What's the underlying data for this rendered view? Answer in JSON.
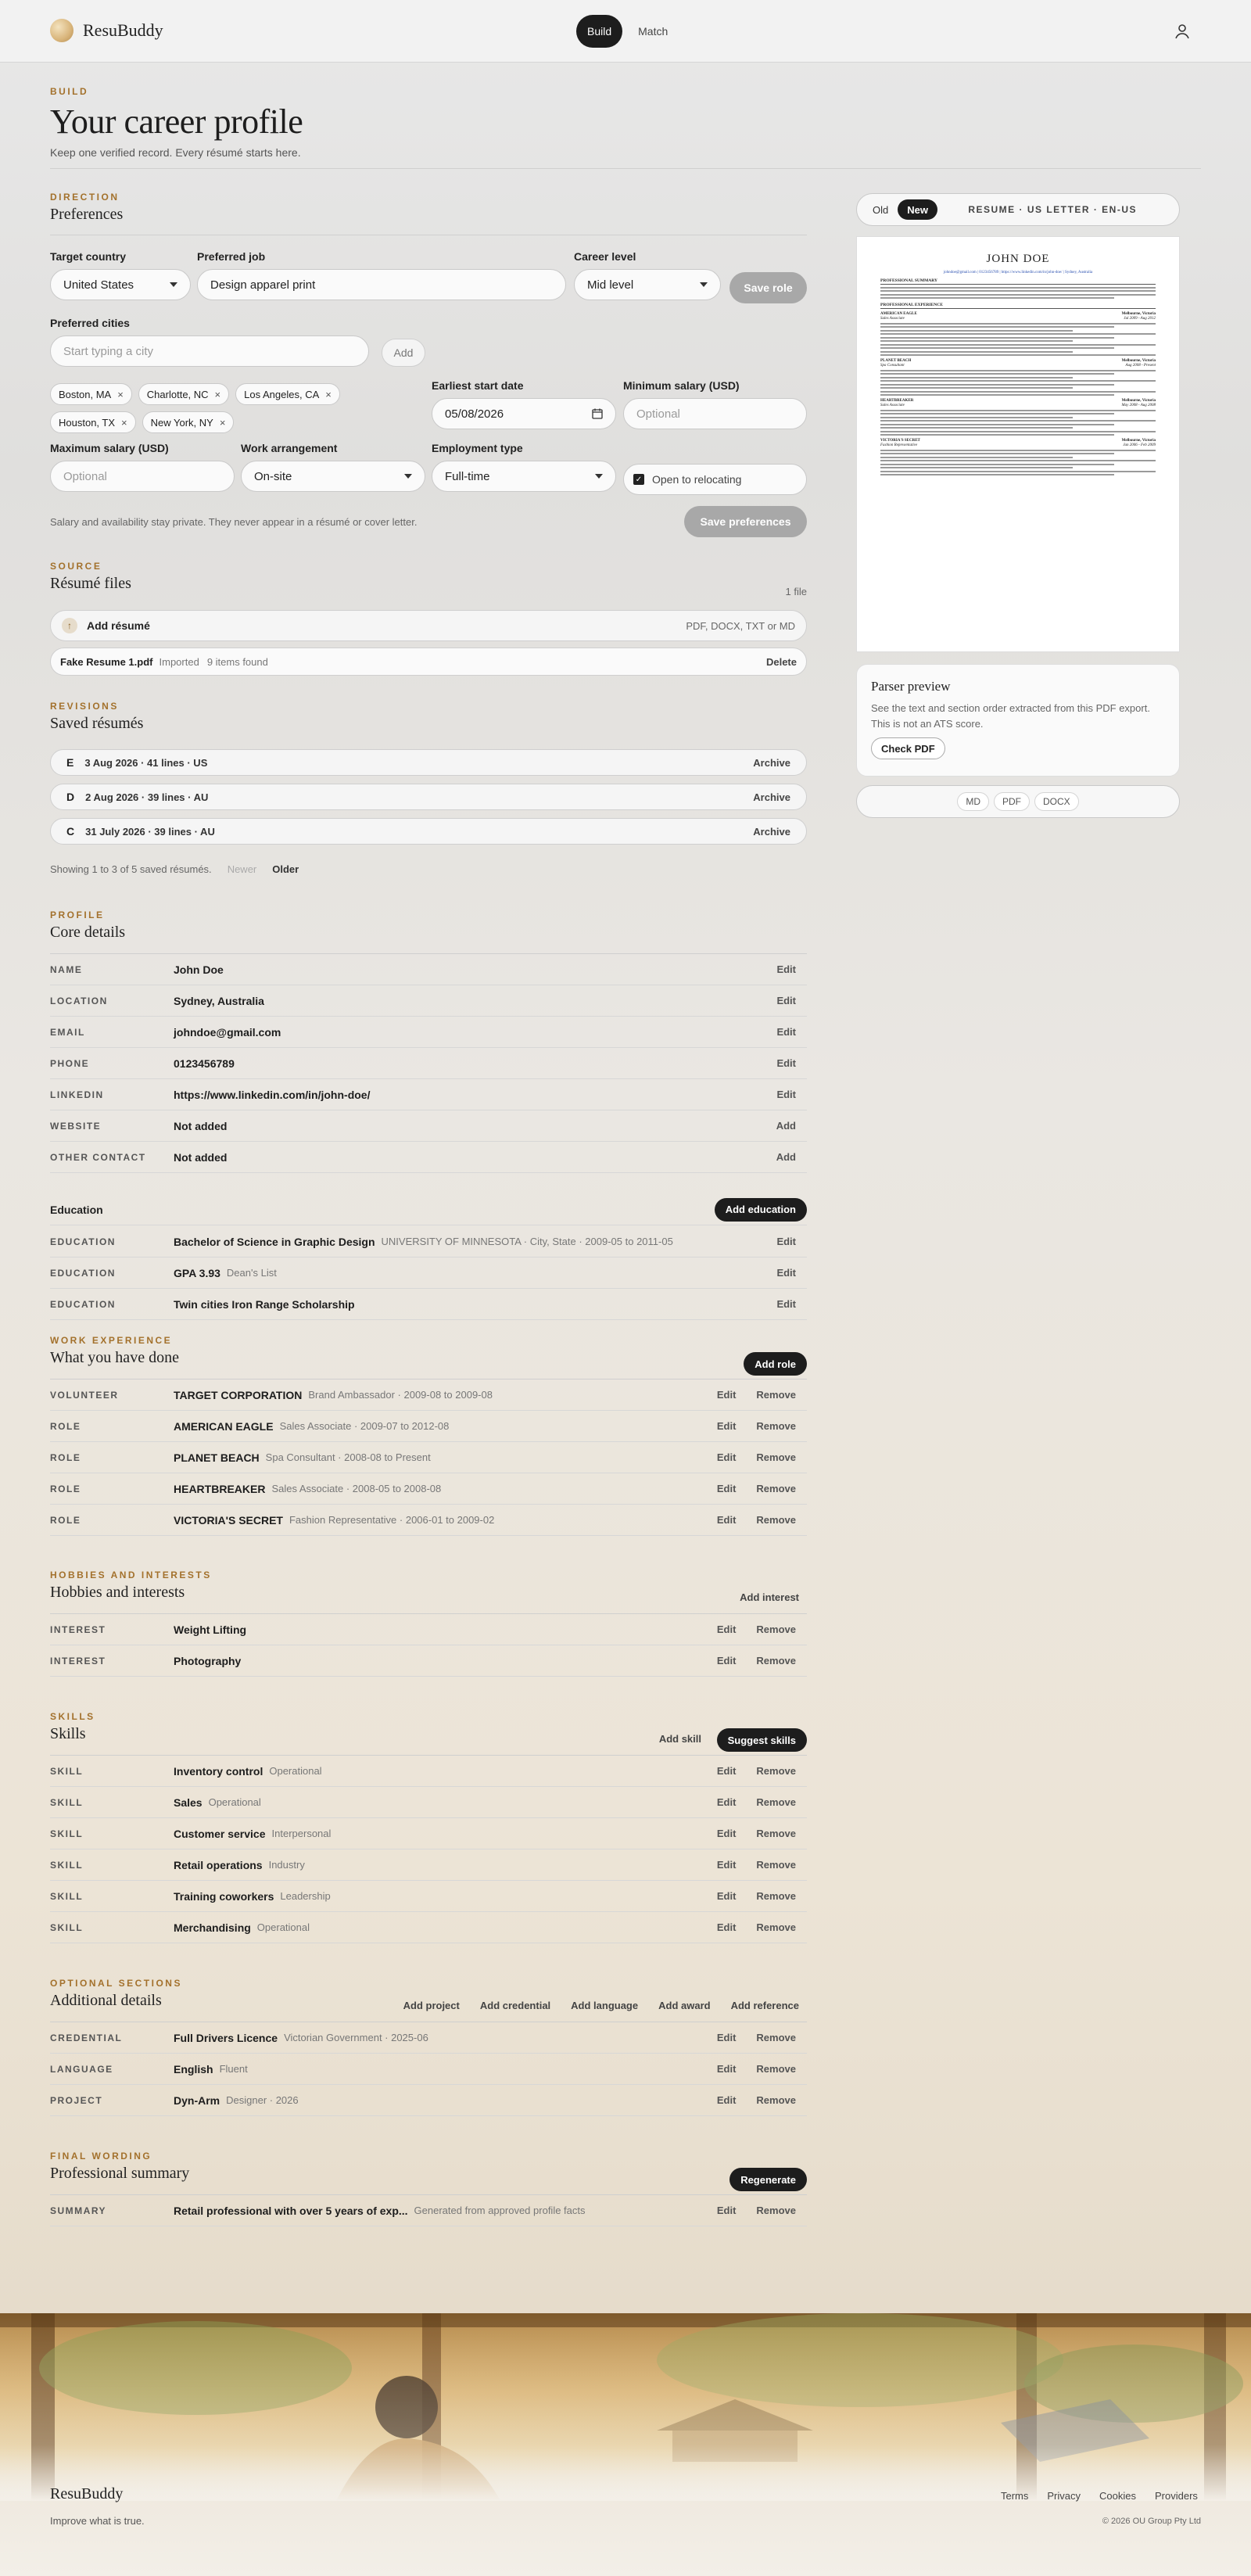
{
  "nav": {
    "brand": "ResuBuddy",
    "tabs": [
      "Build",
      "Match"
    ]
  },
  "header": {
    "eyebrow": "BUILD",
    "title": "Your career profile",
    "subtitle": "Keep one verified record. Every résumé starts here."
  },
  "direction": {
    "eyebrow": "DIRECTION",
    "title": "Preferences",
    "target_country_label": "Target country",
    "target_country": "United States",
    "preferred_job_label": "Preferred job",
    "preferred_job": "Design apparel print",
    "career_level_label": "Career level",
    "career_level": "Mid level",
    "save_role": "Save role",
    "preferred_cities_label": "Preferred cities",
    "city_placeholder": "Start typing a city",
    "add": "Add",
    "cities": [
      "Boston, MA",
      "Charlotte, NC",
      "Los Angeles, CA",
      "Houston, TX",
      "New York, NY"
    ],
    "earliest_start_label": "Earliest start date",
    "earliest_start": "05/08/2026",
    "min_salary_label": "Minimum salary (USD)",
    "min_salary_placeholder": "Optional",
    "max_salary_label": "Maximum salary (USD)",
    "max_salary_placeholder": "Optional",
    "work_arrangement_label": "Work arrangement",
    "work_arrangement": "On-site",
    "employment_type_label": "Employment type",
    "employment_type": "Full-time",
    "relocating": "Open to relocating",
    "privacy_note": "Salary and availability stay private. They never appear in a résumé or cover letter.",
    "save_preferences": "Save preferences"
  },
  "source": {
    "eyebrow": "SOURCE",
    "title": "Résumé files",
    "count": "1 file",
    "add_resume": "Add résumé",
    "formats": "PDF, DOCX, TXT or MD",
    "file_name": "Fake Resume 1.pdf",
    "file_status": "Imported",
    "file_items": "9 items found",
    "delete": "Delete"
  },
  "revisions": {
    "eyebrow": "REVISIONS",
    "title": "Saved résumés",
    "items": [
      {
        "letter": "E",
        "text": "3 Aug 2026 · 41 lines · US",
        "action": "Archive"
      },
      {
        "letter": "D",
        "text": "2 Aug 2026 · 39 lines · AU",
        "action": "Archive"
      },
      {
        "letter": "C",
        "text": "31 July 2026 · 39 lines · AU",
        "action": "Archive"
      }
    ],
    "showing": "Showing 1 to 3 of 5 saved résumés.",
    "newer": "Newer",
    "older": "Older"
  },
  "profile": {
    "eyebrow": "PROFILE",
    "title": "Core details",
    "rows": [
      {
        "k": "NAME",
        "v": "John Doe",
        "a": "Edit"
      },
      {
        "k": "LOCATION",
        "v": "Sydney, Australia",
        "a": "Edit"
      },
      {
        "k": "EMAIL",
        "v": "johndoe@gmail.com",
        "a": "Edit"
      },
      {
        "k": "PHONE",
        "v": "0123456789",
        "a": "Edit"
      },
      {
        "k": "LINKEDIN",
        "v": "https://www.linkedin.com/in/john-doe/",
        "a": "Edit"
      },
      {
        "k": "WEBSITE",
        "v": "Not added",
        "a": "Add"
      },
      {
        "k": "OTHER CONTACT",
        "v": "Not added",
        "a": "Add"
      }
    ],
    "education_title": "Education",
    "add_education": "Add education",
    "education": [
      {
        "k": "EDUCATION",
        "v": "Bachelor of Science in Graphic Design",
        "m": "UNIVERSITY OF MINNESOTA · City, State · 2009-05 to 2011-05",
        "a": "Edit"
      },
      {
        "k": "EDUCATION",
        "v": "GPA 3.93",
        "m": "Dean's List",
        "a": "Edit"
      },
      {
        "k": "EDUCATION",
        "v": "Twin cities Iron Range Scholarship",
        "m": "",
        "a": "Edit"
      }
    ]
  },
  "work": {
    "eyebrow": "WORK EXPERIENCE",
    "title": "What you have done",
    "add_role": "Add role",
    "rows": [
      {
        "k": "VOLUNTEER",
        "v": "TARGET CORPORATION",
        "m": "Brand Ambassador · 2009-08 to 2009-08"
      },
      {
        "k": "ROLE",
        "v": "AMERICAN EAGLE",
        "m": "Sales Associate · 2009-07 to 2012-08"
      },
      {
        "k": "ROLE",
        "v": "PLANET BEACH",
        "m": "Spa Consultant · 2008-08 to Present"
      },
      {
        "k": "ROLE",
        "v": "HEARTBREAKER",
        "m": "Sales Associate · 2008-05 to 2008-08"
      },
      {
        "k": "ROLE",
        "v": "VICTORIA'S SECRET",
        "m": "Fashion Representative · 2006-01 to 2009-02"
      }
    ],
    "edit": "Edit",
    "remove": "Remove"
  },
  "hobbies": {
    "eyebrow": "HOBBIES AND INTERESTS",
    "title": "Hobbies and interests",
    "add_interest": "Add interest",
    "rows": [
      {
        "k": "INTEREST",
        "v": "Weight Lifting"
      },
      {
        "k": "INTEREST",
        "v": "Photography"
      }
    ]
  },
  "skills": {
    "eyebrow": "SKILLS",
    "title": "Skills",
    "add_skill": "Add skill",
    "suggest": "Suggest skills",
    "rows": [
      {
        "k": "SKILL",
        "v": "Inventory control",
        "m": "Operational"
      },
      {
        "k": "SKILL",
        "v": "Sales",
        "m": "Operational"
      },
      {
        "k": "SKILL",
        "v": "Customer service",
        "m": "Interpersonal"
      },
      {
        "k": "SKILL",
        "v": "Retail operations",
        "m": "Industry"
      },
      {
        "k": "SKILL",
        "v": "Training coworkers",
        "m": "Leadership"
      },
      {
        "k": "SKILL",
        "v": "Merchandising",
        "m": "Operational"
      }
    ]
  },
  "optional": {
    "eyebrow": "OPTIONAL SECTIONS",
    "title": "Additional details",
    "actions": [
      "Add project",
      "Add credential",
      "Add language",
      "Add award",
      "Add reference"
    ],
    "rows": [
      {
        "k": "CREDENTIAL",
        "v": "Full Drivers Licence",
        "m": "Victorian Government · 2025-06"
      },
      {
        "k": "LANGUAGE",
        "v": "English",
        "m": "Fluent"
      },
      {
        "k": "PROJECT",
        "v": "Dyn-Arm",
        "m": "Designer · 2026"
      }
    ]
  },
  "final": {
    "eyebrow": "FINAL WORDING",
    "title": "Professional summary",
    "regenerate": "Regenerate",
    "row": {
      "k": "SUMMARY",
      "v": "Retail professional with over 5 years of exp...",
      "m": "Generated from approved profile facts"
    }
  },
  "preview": {
    "old": "Old",
    "new": "New",
    "meta": "RESUME · US LETTER · EN-US",
    "resume_name": "JOHN DOE",
    "resume_contact": "johndoe@gmail.com | 0123456789 | https://www.linkedin.com/in/john-doe/ | Sydney, Australia",
    "h_summary": "PROFESSIONAL SUMMARY",
    "h_experience": "PROFESSIONAL EXPERIENCE",
    "jobs": [
      {
        "co": "AMERICAN EAGLE",
        "loc": "Melbourne, Victoria",
        "title": "Sales Associate",
        "dates": "Jul 2009 - Aug 2012"
      },
      {
        "co": "PLANET BEACH",
        "loc": "Melbourne, Victoria",
        "title": "Spa Consultant",
        "dates": "Aug 2008 - Present"
      },
      {
        "co": "HEARTBREAKER",
        "loc": "Melbourne, Victoria",
        "title": "Sales Associate",
        "dates": "May 2008 - Aug 2008"
      },
      {
        "co": "VICTORIA'S SECRET",
        "loc": "Melbourne, Victoria",
        "title": "Fashion Representative",
        "dates": "Jan 2006 - Feb 2009"
      }
    ],
    "parser_title": "Parser preview",
    "parser_text": "See the text and section order extracted from this PDF export. This is not an ATS score.",
    "check_pdf": "Check PDF",
    "formats": [
      "MD",
      "PDF",
      "DOCX"
    ]
  },
  "footer": {
    "brand": "ResuBuddy",
    "tagline": "Improve what is true.",
    "links": [
      "Terms",
      "Privacy",
      "Cookies",
      "Providers"
    ],
    "copyright": "© 2026 OU Group Pty Ltd"
  },
  "colors": {
    "accent": "#a3712c",
    "dark": "#1d1d1d"
  }
}
